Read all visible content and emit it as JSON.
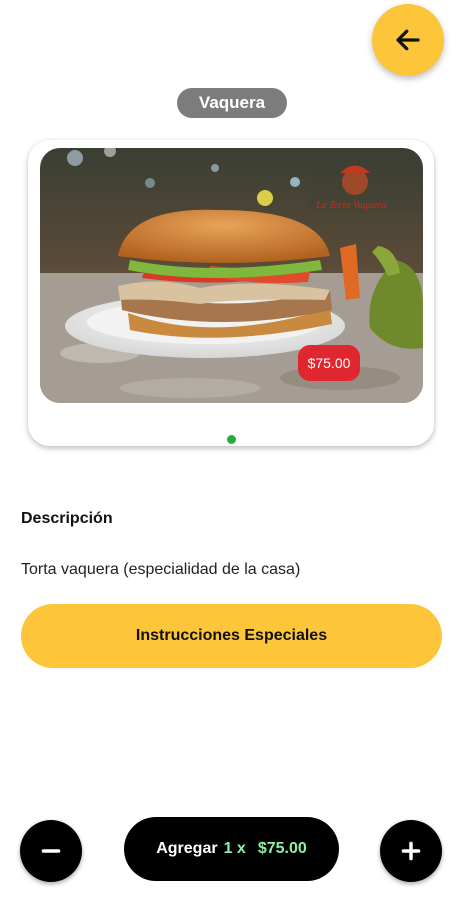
{
  "header": {
    "back_icon": "arrow-left-icon",
    "title": "Vaquera"
  },
  "product": {
    "image_alt": "Torta vaquera",
    "logo_text": "La Torta Vaquera",
    "price_label": "$75.00"
  },
  "description": {
    "heading": "Descripción",
    "text": "Torta vaquera (especialidad de la casa)"
  },
  "actions": {
    "instructions_label": "Instrucciones Especiales",
    "add_label": "Agregar",
    "quantity_text": "1 x",
    "total_price": "$75.00",
    "minus_icon": "minus-icon",
    "plus_icon": "plus-icon"
  },
  "colors": {
    "accent_yellow": "#fcc53a",
    "title_badge_gray": "#7c7c7c",
    "price_badge_red": "#e0262f",
    "price_green": "#8ff0a4",
    "dot_green": "#27ae3c"
  }
}
